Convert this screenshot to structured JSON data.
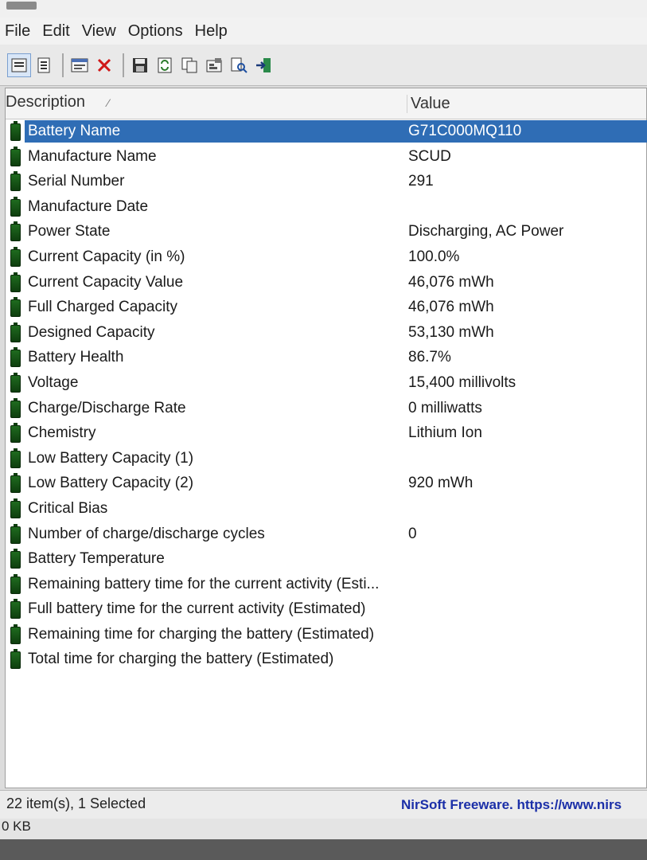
{
  "menu": [
    "File",
    "Edit",
    "View",
    "Options",
    "Help"
  ],
  "toolbar_icons": [
    "properties-icon",
    "copy-report-icon",
    "html-report-icon",
    "delete-icon",
    "save-icon",
    "refresh-icon",
    "copy-icon",
    "settings-icon",
    "find-icon",
    "exit-icon"
  ],
  "columns": {
    "description": "Description",
    "value": "Value"
  },
  "rows": [
    {
      "label": "Battery Name",
      "value": "G71C000MQ110"
    },
    {
      "label": "Manufacture Name",
      "value": "SCUD"
    },
    {
      "label": "Serial Number",
      "value": "291"
    },
    {
      "label": "Manufacture Date",
      "value": ""
    },
    {
      "label": "Power State",
      "value": "Discharging, AC Power"
    },
    {
      "label": "Current Capacity (in %)",
      "value": "100.0%"
    },
    {
      "label": "Current Capacity Value",
      "value": "46,076 mWh"
    },
    {
      "label": "Full Charged Capacity",
      "value": "46,076 mWh"
    },
    {
      "label": "Designed Capacity",
      "value": "53,130 mWh"
    },
    {
      "label": "Battery Health",
      "value": "86.7%"
    },
    {
      "label": "Voltage",
      "value": "15,400 millivolts"
    },
    {
      "label": "Charge/Discharge Rate",
      "value": "0 milliwatts"
    },
    {
      "label": "Chemistry",
      "value": "Lithium Ion"
    },
    {
      "label": "Low Battery Capacity (1)",
      "value": ""
    },
    {
      "label": "Low Battery Capacity (2)",
      "value": "920 mWh"
    },
    {
      "label": "Critical Bias",
      "value": ""
    },
    {
      "label": "Number of charge/discharge cycles",
      "value": "0"
    },
    {
      "label": "Battery Temperature",
      "value": ""
    },
    {
      "label": "Remaining battery time for the current activity (Esti...",
      "value": ""
    },
    {
      "label": "Full battery time for the current activity (Estimated)",
      "value": ""
    },
    {
      "label": "Remaining time for charging the battery (Estimated)",
      "value": ""
    },
    {
      "label": "Total  time for charging the battery (Estimated)",
      "value": ""
    }
  ],
  "status": {
    "items": "22 item(s), 1 Selected",
    "link": "NirSoft Freeware. https://www.nirs",
    "size": "0 KB"
  },
  "colors": {
    "selection": "#2f6db5",
    "link": "#1b2fa8",
    "battery": "#1f6b1f"
  }
}
